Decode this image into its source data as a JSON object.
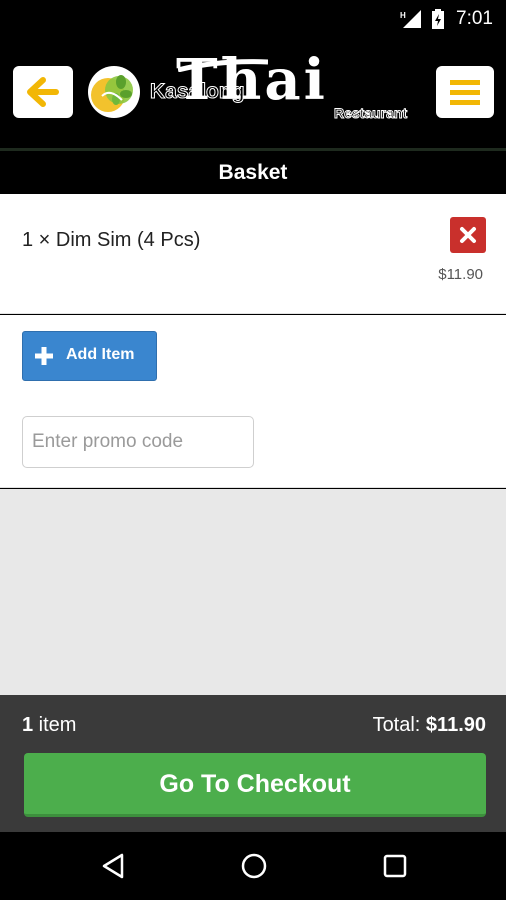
{
  "status_bar": {
    "time": "7:01",
    "icons": [
      "signal-icon",
      "battery-charging-icon"
    ]
  },
  "header": {
    "logo": {
      "name": "Kasalong",
      "wordmark": "Thai",
      "subtitle": "Restaurant"
    },
    "icons": {
      "back": "arrow-left-icon",
      "menu": "hamburger-menu-icon"
    },
    "colors": {
      "accent": "#f2b705"
    }
  },
  "page": {
    "title": "Basket"
  },
  "basket": {
    "items": [
      {
        "line": "1 × Dim Sim (4 Pcs)",
        "price": "$11.90"
      }
    ]
  },
  "actions": {
    "add_item_label": "Add Item",
    "promo_placeholder": "Enter promo code",
    "promo_value": ""
  },
  "summary": {
    "count_number": "1",
    "count_unit": " item",
    "total_label": "Total: ",
    "total_value": "$11.90",
    "checkout_label": "Go To Checkout"
  },
  "colors": {
    "remove": "#c9302c",
    "add_button": "#3a86cf",
    "checkout": "#4cae4c",
    "footer": "#3a3a3a"
  },
  "nav": {
    "icons": [
      "back-triangle-icon",
      "home-circle-icon",
      "recents-square-icon"
    ]
  }
}
